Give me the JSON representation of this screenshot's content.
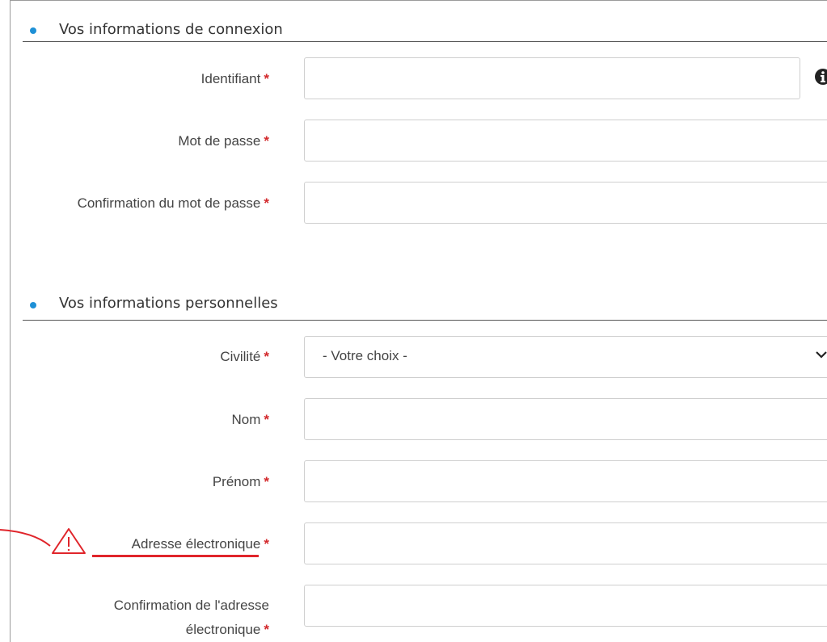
{
  "section_login": {
    "title": "Vos informations de connexion",
    "fields": {
      "username": {
        "label": "Identifiant",
        "required_mark": "*",
        "value": ""
      },
      "password": {
        "label": "Mot de passe",
        "required_mark": "*",
        "value": ""
      },
      "password_confirm": {
        "label": "Confirmation du mot de passe",
        "required_mark": "*",
        "value": ""
      }
    }
  },
  "section_personal": {
    "title": "Vos informations personnelles",
    "fields": {
      "civility": {
        "label": "Civilité",
        "required_mark": "*",
        "selected": "- Votre choix -"
      },
      "last_name": {
        "label": "Nom",
        "required_mark": "*",
        "value": ""
      },
      "first_name": {
        "label": "Prénom",
        "required_mark": "*",
        "value": ""
      },
      "email": {
        "label": "Adresse électronique",
        "required_mark": "*",
        "value": ""
      },
      "email_confirm": {
        "label_line1": "Confirmation de l'adresse",
        "label_line2": "électronique",
        "required_mark": "*",
        "value": ""
      }
    }
  },
  "icons": {
    "info": "info-icon",
    "dropdown": "chevron-down-icon",
    "warning": "warning-triangle-icon"
  },
  "colors": {
    "accent_bullet": "#1e90d6",
    "required_star": "#d3292c",
    "warning_annotation": "#e0252b"
  }
}
